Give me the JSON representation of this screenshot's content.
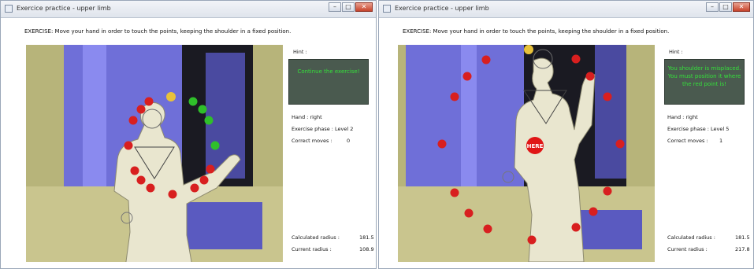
{
  "left_window": {
    "title": "Exercice practice - upper limb",
    "instruction": "EXERCISE: Move your hand in order to touch the points, keeping the shoulder in a fixed position.",
    "hint_label": "Hint :",
    "hint_lines": [
      "Continue the exercise!"
    ],
    "hand": "Hand : right",
    "phase": "Exercise phase : Level 2",
    "correct_moves_label": "Correct moves :",
    "correct_moves_value": "0",
    "calculated_radius_label": "Calculated radius :",
    "calculated_radius_value": "181.5",
    "current_radius_label": "Current radius :",
    "current_radius_value": "108.9"
  },
  "right_window": {
    "title": "Exercice practice - upper limb",
    "instruction": "EXERCISE: Move your hand in order to touch the points, keeping the shoulder in a fixed position.",
    "hint_label": "Hint :",
    "hint_lines": [
      "You shoulder is misplaced.",
      "You must position it where",
      "the red point is!"
    ],
    "hand": "Hand : right",
    "phase": "Exercise phase : Level 5",
    "correct_moves_label": "Correct moves :",
    "correct_moves_value": "1",
    "calculated_radius_label": "Calculated radius :",
    "calculated_radius_value": "181.5",
    "current_radius_label": "Current radius :",
    "current_radius_value": "217.8",
    "here_marker": "HERE"
  },
  "colors": {
    "hint_bg": "#4a5a4f",
    "hint_text": "#35e03b",
    "point_red": "#d81f1f",
    "point_green": "#2fbf2a",
    "point_yellow": "#e8c23a",
    "depth_purple": "#6f6fd8",
    "depth_olive": "#b7b47a"
  }
}
